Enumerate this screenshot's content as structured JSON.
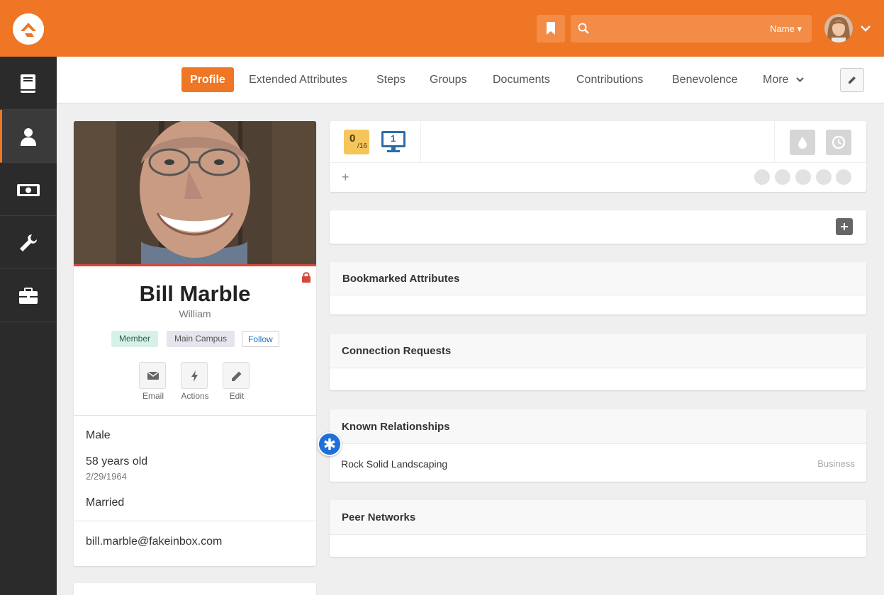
{
  "header": {
    "search_placeholder": "",
    "search_filter_label": "Name"
  },
  "sidebar": {
    "items": [
      {
        "icon": "book-icon"
      },
      {
        "icon": "person-icon",
        "active": true
      },
      {
        "icon": "money-icon"
      },
      {
        "icon": "wrench-icon"
      },
      {
        "icon": "briefcase-icon"
      }
    ]
  },
  "tabs": [
    {
      "label": "Profile",
      "active": true
    },
    {
      "label": "Extended Attributes"
    },
    {
      "label": "Steps"
    },
    {
      "label": "Groups"
    },
    {
      "label": "Documents"
    },
    {
      "label": "Contributions"
    },
    {
      "label": "Benevolence"
    },
    {
      "label": "More"
    }
  ],
  "person": {
    "name": "Bill Marble",
    "nickname": "William",
    "badges": {
      "member": "Member",
      "campus": "Main Campus",
      "follow": "Follow"
    },
    "actions": {
      "email": "Email",
      "actions": "Actions",
      "edit": "Edit"
    },
    "gender": "Male",
    "age": "58 years old",
    "birthdate": "2/29/1964",
    "marital_status": "Married",
    "email": "bill.marble@fakeinbox.com"
  },
  "badge_bar": {
    "score_value": "0",
    "score_total": "/16",
    "monitor_count": "1",
    "add_label": "+"
  },
  "panels": {
    "bookmarked_attributes": "Bookmarked Attributes",
    "connection_requests": "Connection Requests",
    "known_relationships": "Known Relationships",
    "peer_networks": "Peer Networks"
  },
  "known_relationships": [
    {
      "name": "Rock Solid Landscaping",
      "role": "Business"
    }
  ],
  "colors": {
    "brand": "#ee7624",
    "sidebar": "#2b2b2b",
    "lock": "#d9473b",
    "member_badge": "#d8f1e8",
    "score_badge": "#f6c55a",
    "float_button": "#1e6fd9"
  }
}
